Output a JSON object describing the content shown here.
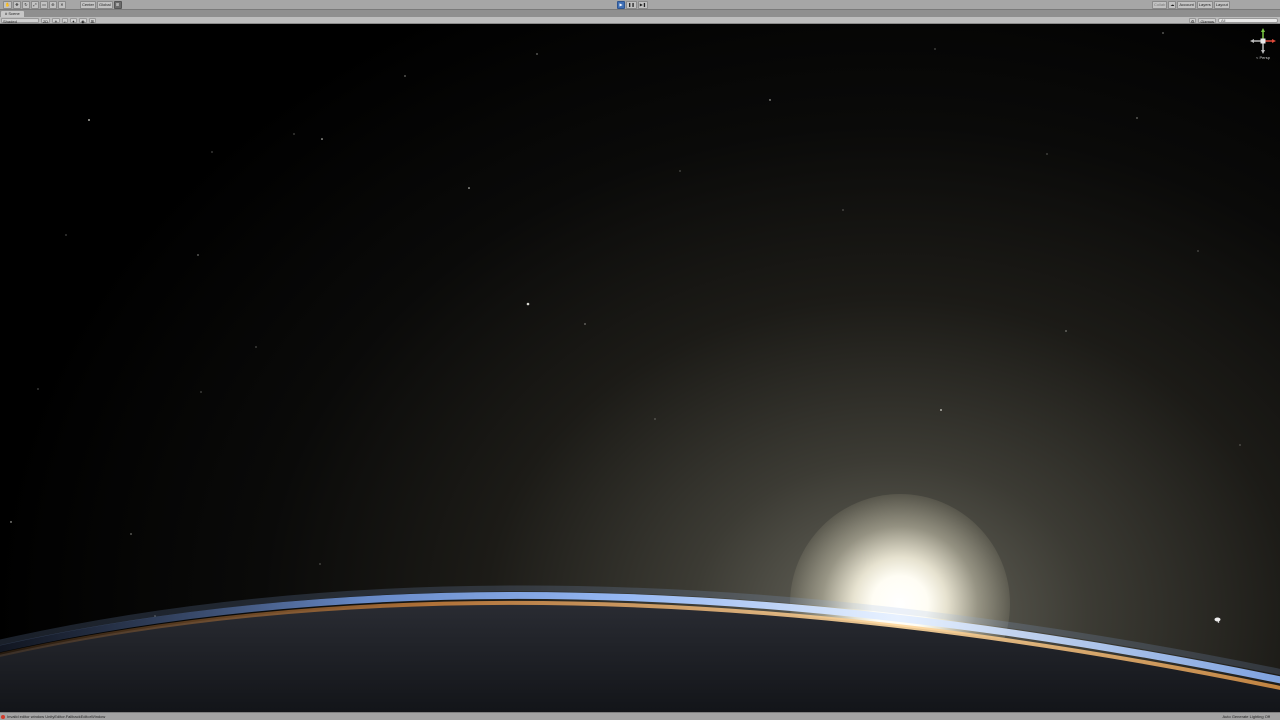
{
  "toolbar": {
    "left_tools": [
      "hand-tool",
      "move-tool",
      "rotate-tool",
      "scale-tool",
      "rect-tool",
      "transform-tool",
      "custom-tool"
    ],
    "pivot_label": "Center",
    "handle_label": "Global",
    "playback": [
      "play",
      "pause",
      "step"
    ],
    "collab_label": "Collab",
    "account_label": "Account",
    "layers_label": "Layers",
    "layout_label": "Layout"
  },
  "tabs": {
    "scene_label": "# Scene"
  },
  "scene_toolbar": {
    "shading_mode": "Shaded",
    "mode_2d": "2D",
    "gizmos_label": "Gizmos",
    "search_placeholder": "All"
  },
  "viewport": {
    "projection_label": "< Persp"
  },
  "status": {
    "message": "Invalid editor window UnityEditor.FallbackEditorWindow",
    "right_text": "Auto Generate Lighting Off"
  },
  "colors": {
    "accent": "#3f6fb5",
    "error": "#d23a2a"
  }
}
